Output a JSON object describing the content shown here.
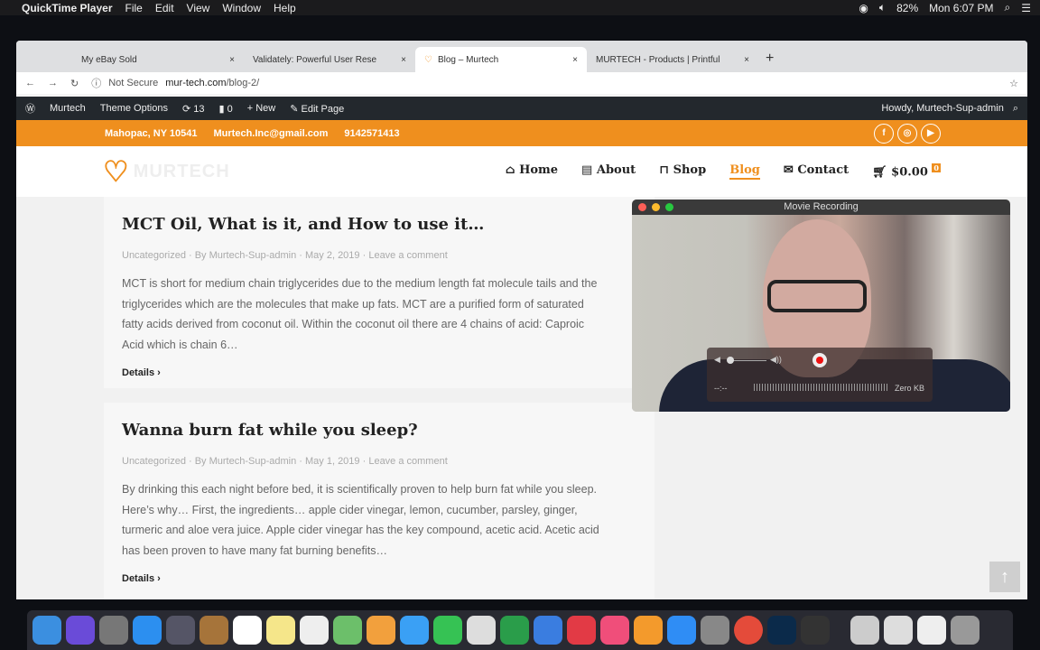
{
  "menubar": {
    "app": "QuickTime Player",
    "items": [
      "File",
      "Edit",
      "View",
      "Window",
      "Help"
    ],
    "battery": "82%",
    "clock": "Mon 6:07 PM"
  },
  "tabs": [
    {
      "label": "My eBay Sold"
    },
    {
      "label": "Validately: Powerful User Rese"
    },
    {
      "label": "Blog – Murtech"
    },
    {
      "label": "MURTECH - Products | Printful"
    }
  ],
  "address": {
    "security": "Not Secure",
    "host": "mur-tech.com",
    "path": "/blog-2/"
  },
  "wpbar": {
    "site": "Murtech",
    "theme_options": "Theme Options",
    "updates": "13",
    "comments": "0",
    "new": "New",
    "edit": "Edit Page",
    "howdy": "Howdy, Murtech-Sup-admin"
  },
  "topbar": {
    "location": "Mahopac, NY 10541",
    "email": "Murtech.Inc@gmail.com",
    "phone": "9142571413"
  },
  "logo": "MURTECH",
  "nav": {
    "home": "Home",
    "about": "About",
    "shop": "Shop",
    "blog": "Blog",
    "contact": "Contact",
    "cart": "$0.00",
    "cart_count": "0"
  },
  "posts": [
    {
      "title": "MCT Oil, What is it, and How to use it…",
      "category": "Uncategorized",
      "author": "By Murtech-Sup-admin",
      "date": "May 2, 2019",
      "comment": "Leave a comment",
      "excerpt": [
        "MCT is short for medium chain triglycerides due to the medium length fat molecule tails and the",
        "triglycerides which are the molecules that make up fats. MCT are a purified form of saturated",
        "fatty acids derived from coconut oil. Within the coconut oil there are 4 chains of acid: Caproic",
        "Acid which is chain 6…"
      ],
      "more": "Details"
    },
    {
      "title": "Wanna burn fat while you sleep?",
      "category": "Uncategorized",
      "author": "By Murtech-Sup-admin",
      "date": "May 1, 2019",
      "comment": "Leave a comment",
      "excerpt": [
        "By drinking this each night before bed, it is scientifically proven to help burn fat while you sleep.",
        "Here’s why… First, the ingredients… apple cider vinegar, lemon, cucumber, parsley, ginger,",
        "turmeric and aloe vera juice. Apple cider vinegar has the key compound, acetic acid. Acetic acid",
        "has been proven to have many fat burning benefits…"
      ],
      "more": "Details"
    }
  ],
  "recording": {
    "title": "Movie Recording",
    "time": "--:--",
    "size": "Zero KB",
    "volume": 0.05
  },
  "colors": {
    "accent": "#ef8f1e",
    "wpbar": "#23282d"
  }
}
